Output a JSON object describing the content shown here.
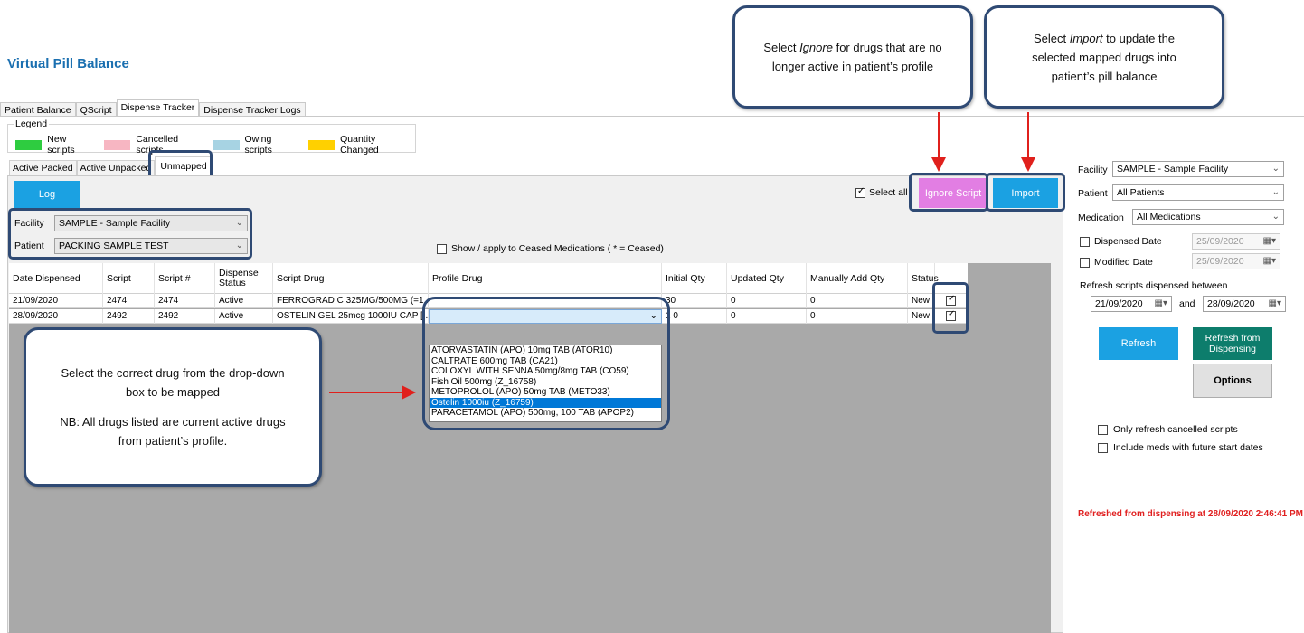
{
  "app": {
    "title": "Virtual Pill Balance"
  },
  "tabs": [
    "Patient Balance",
    "QScript",
    "Dispense Tracker",
    "Dispense Tracker Logs"
  ],
  "legend": {
    "title": "Legend",
    "items": [
      {
        "label": "New scripts",
        "color": "#2ecc40"
      },
      {
        "label": "Cancelled scripts",
        "color": "#f7b6c2"
      },
      {
        "label": "Owing scripts",
        "color": "#a7d3e3"
      },
      {
        "label": "Quantity Changed",
        "color": "#ffd000"
      }
    ]
  },
  "subtabs": [
    "Active Packed",
    "Active Unpacked",
    "Unmapped"
  ],
  "toolbar": {
    "log_label": "Log",
    "select_all_label": "Select all",
    "ignore_label": "Ignore Script",
    "import_label": "Import"
  },
  "filters": {
    "facility_label": "Facility",
    "facility_value": "SAMPLE - Sample Facility",
    "patient_label": "Patient",
    "patient_value": "PACKING SAMPLE TEST",
    "ceased_label": "Show / apply to Ceased Medications ( * = Ceased)"
  },
  "grid": {
    "headers": [
      "Date Dispensed",
      "Script",
      "Script #",
      "Dispense Status",
      "Script Drug",
      "Profile Drug",
      "Initial Qty",
      "Updated Qty",
      "Manually Add Qty",
      "Status"
    ],
    "rows": [
      [
        "21/09/2020",
        "2474",
        "2474",
        "Active",
        "FERROGRAD C 325MG/500MG (=1...",
        "",
        "30",
        "0",
        "0",
        "New"
      ],
      [
        "28/09/2020",
        "2492",
        "2492",
        "Active",
        "OSTELIN GEL 25mcg 1000IU CAP [...",
        "",
        "1 0",
        "0",
        "0",
        "New"
      ]
    ]
  },
  "dropdown": {
    "options": [
      "ATORVASTATIN (APO) 10mg TAB (ATOR10)",
      "CALTRATE 600mg TAB (CA21)",
      "COLOXYL WITH SENNA 50mg/8mg TAB (CO59)",
      "Fish Oil 500mg (Z_16758)",
      "METOPROLOL (APO) 50mg TAB (METO33)",
      "Ostelin 1000iu (Z_16759)",
      "PARACETAMOL (APO) 500mg, 100 TAB (APOP2)"
    ],
    "selected_index": 5
  },
  "right_panel": {
    "facility_label": "Facility",
    "facility_value": "SAMPLE - Sample Facility",
    "patient_label": "Patient",
    "patient_value": "All Patients",
    "medication_label": "Medication",
    "medication_value": "All Medications",
    "dispensed_date_label": "Dispensed Date",
    "dispensed_date_value": "25/09/2020",
    "modified_date_label": "Modified Date",
    "modified_date_value": "25/09/2020",
    "range_label": "Refresh scripts dispensed between",
    "range_from": "21/09/2020",
    "range_and": "and",
    "range_to": "28/09/2020",
    "refresh_label": "Refresh",
    "refresh_dispensing_label": "Refresh from Dispensing",
    "options_label": "Options",
    "only_cancelled_label": "Only refresh cancelled scripts",
    "future_dates_label": "Include meds with future start dates",
    "status_text": "Refreshed from dispensing at 28/09/2020 2:46:41 PM"
  },
  "callouts": {
    "ignore_pre": "Select ",
    "ignore_em": "Ignore",
    "ignore_post": " for drugs that are no longer active in patient’s profile",
    "import_pre": "Select ",
    "import_em": "Import",
    "import_post": " to update the selected mapped drugs into patient’s pill balance",
    "dropdown_line1": "Select the correct drug from the drop-down box to be mapped",
    "dropdown_line2": "NB: All drugs listed are current active drugs from patient’s profile."
  }
}
